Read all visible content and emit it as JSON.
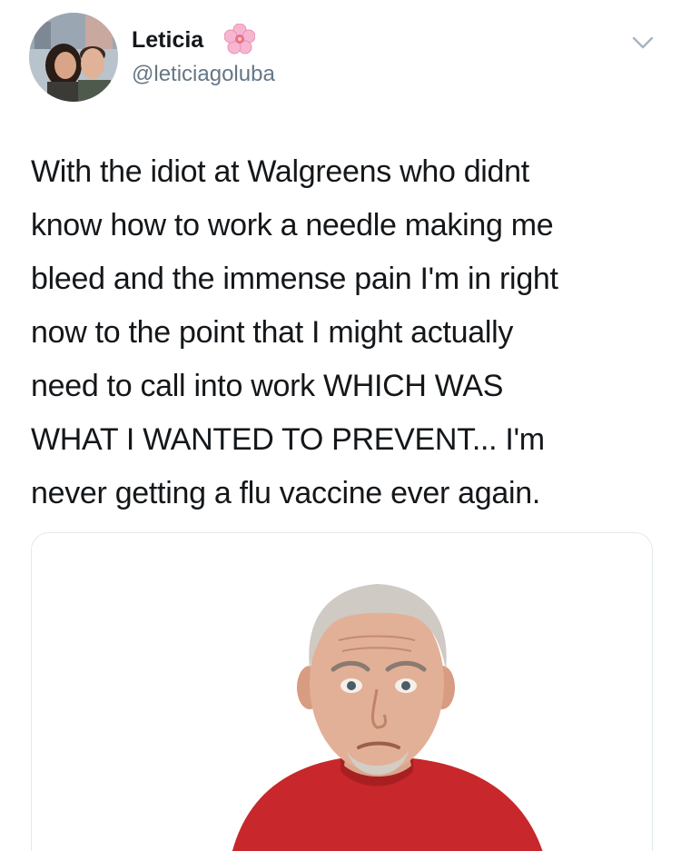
{
  "author": {
    "display_name": "Leticia",
    "name_emoji": "cherry-blossom-icon",
    "handle": "@leticiagoluba",
    "avatar": "couple-photo"
  },
  "menu_icon": "chevron-down-icon",
  "tweet": {
    "lines": [
      "With the idiot at Walgreens who didnt",
      "know how to work a needle making me",
      "bleed and the immense pain I'm in right",
      "now to the point that I might actually",
      "need to call into work WHICH WAS",
      "WHAT I WANTED TO PREVENT... I'm",
      "never getting a flu vaccine ever again."
    ]
  },
  "media": {
    "description_icon": "shrugging-old-man-photo"
  },
  "colors": {
    "text": "#14171a",
    "secondary": "#657786",
    "border": "#e1e8ed",
    "sweater": "#c8282b"
  }
}
